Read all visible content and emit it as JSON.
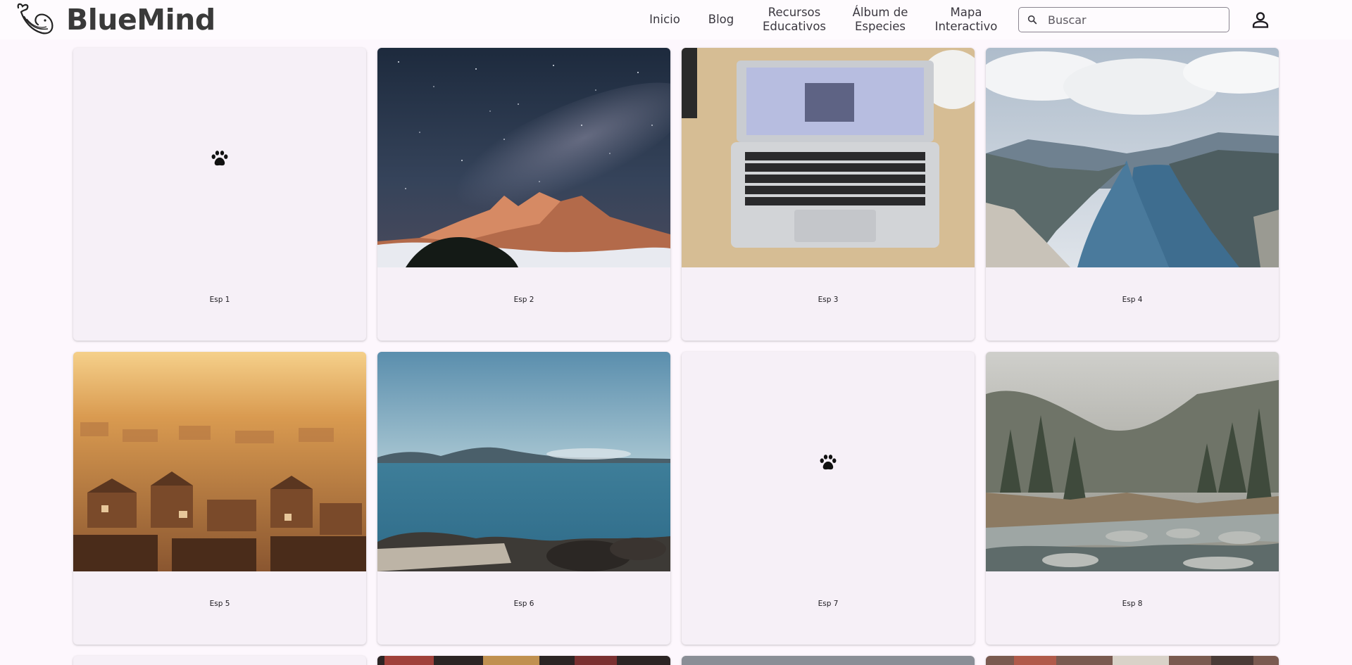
{
  "header": {
    "brand": "BlueMind",
    "nav": [
      {
        "label": "Inicio"
      },
      {
        "label": "Blog"
      },
      {
        "label": "Recursos\nEducativos"
      },
      {
        "label": "Álbum de\nEspecies"
      },
      {
        "label": "Mapa\nInteractivo"
      }
    ],
    "search": {
      "placeholder": "Buscar",
      "value": ""
    },
    "icons": {
      "logo": "whale-logo-icon",
      "search": "search-icon",
      "account": "person-icon"
    }
  },
  "cards": [
    {
      "label": "Esp 1",
      "image": "none",
      "icon": "paw-icon"
    },
    {
      "label": "Esp 2",
      "image": "milky-way-mountain"
    },
    {
      "label": "Esp 3",
      "image": "laptop-on-desk"
    },
    {
      "label": "Esp 4",
      "image": "fjord-landscape"
    },
    {
      "label": "Esp 5",
      "image": "city-sunset"
    },
    {
      "label": "Esp 6",
      "image": "sea-coast"
    },
    {
      "label": "Esp 7",
      "image": "none",
      "icon": "paw-icon"
    },
    {
      "label": "Esp 8",
      "image": "forest-river"
    }
  ],
  "colors": {
    "background": "#fdf7fd",
    "card": "#f6f0f7",
    "text": "#1d1b20"
  }
}
